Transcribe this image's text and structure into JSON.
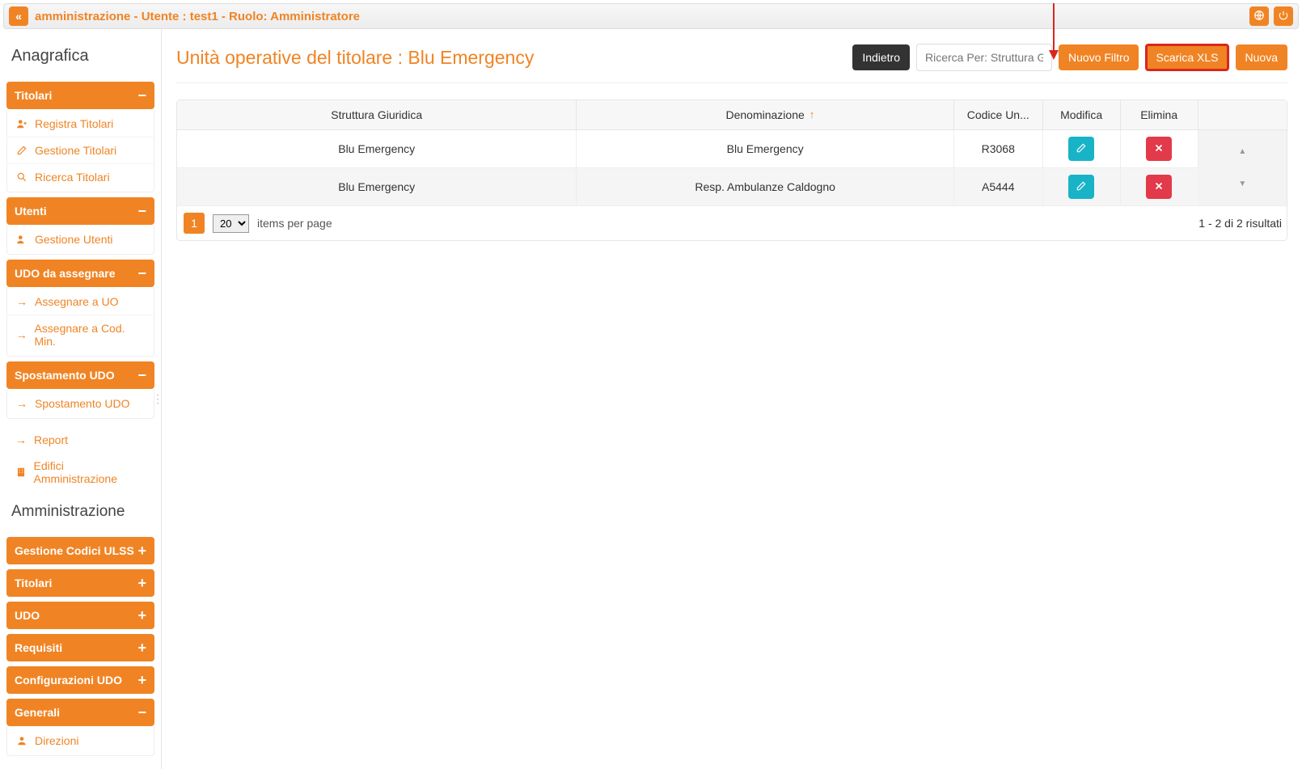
{
  "topbar": {
    "title": "amministrazione - Utente : test1 - Ruolo: Amministratore"
  },
  "sidebar": {
    "heading_anagrafica": "Anagrafica",
    "heading_amministrazione": "Amministrazione",
    "section_titolari": {
      "label": "Titolari",
      "items": [
        "Registra Titolari",
        "Gestione Titolari",
        "Ricerca Titolari"
      ]
    },
    "section_utenti": {
      "label": "Utenti",
      "items": [
        "Gestione Utenti"
      ]
    },
    "section_udo": {
      "label": "UDO da assegnare",
      "items": [
        "Assegnare a UO",
        "Assegnare a Cod. Min."
      ]
    },
    "section_spostamento": {
      "label": "Spostamento UDO",
      "items": [
        "Spostamento UDO"
      ]
    },
    "loose_links": [
      "Report",
      "Edifici Amministrazione"
    ],
    "admin_sections": [
      {
        "label": "Gestione Codici ULSS",
        "expanded": false
      },
      {
        "label": "Titolari",
        "expanded": false
      },
      {
        "label": "UDO",
        "expanded": false
      },
      {
        "label": "Requisiti",
        "expanded": false
      },
      {
        "label": "Configurazioni UDO",
        "expanded": false
      },
      {
        "label": "Generali",
        "expanded": true,
        "items": [
          "Direzioni"
        ]
      }
    ]
  },
  "page": {
    "title": "Unità operative del titolare : Blu Emergency",
    "btn_back": "Indietro",
    "search_placeholder": "Ricerca Per: Struttura Giurid...",
    "btn_newfilter": "Nuovo Filtro",
    "btn_download": "Scarica XLS",
    "btn_new": "Nuova"
  },
  "table": {
    "columns": {
      "struttura": "Struttura Giuridica",
      "denominazione": "Denominazione",
      "codice": "Codice Un...",
      "modifica": "Modifica",
      "elimina": "Elimina"
    },
    "rows": [
      {
        "struttura": "Blu Emergency",
        "denominazione": "Blu Emergency",
        "codice": "R3068"
      },
      {
        "struttura": "Blu Emergency",
        "denominazione": "Resp. Ambulanze Caldogno",
        "codice": "A5444"
      }
    ]
  },
  "pager": {
    "current": "1",
    "per_page": "20",
    "per_page_label": "items per page",
    "results": "1 - 2 di 2 risultati"
  }
}
